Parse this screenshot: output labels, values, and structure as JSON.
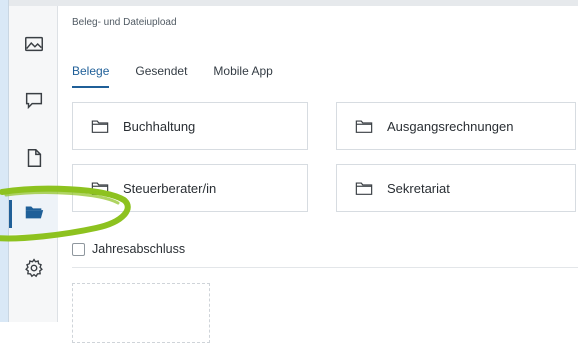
{
  "breadcrumb": "Beleg- und Dateiupload",
  "sidebar": {
    "items": [
      {
        "icon": "image-icon"
      },
      {
        "icon": "chat-icon"
      },
      {
        "icon": "document-icon"
      },
      {
        "icon": "folder-open-icon",
        "active": true
      },
      {
        "icon": "gear-icon"
      }
    ]
  },
  "tabs": [
    {
      "label": "Belege",
      "active": true
    },
    {
      "label": "Gesendet"
    },
    {
      "label": "Mobile App"
    }
  ],
  "folders": [
    {
      "label": "Buchhaltung"
    },
    {
      "label": "Ausgangsrechnungen"
    },
    {
      "label": "Steuerberater/in"
    },
    {
      "label": "Sekretariat"
    }
  ],
  "checkbox": {
    "label": "Jahresabschluss",
    "checked": false
  },
  "colors": {
    "accent": "#1f5f98",
    "highlight_ring": "#8dc21f"
  }
}
